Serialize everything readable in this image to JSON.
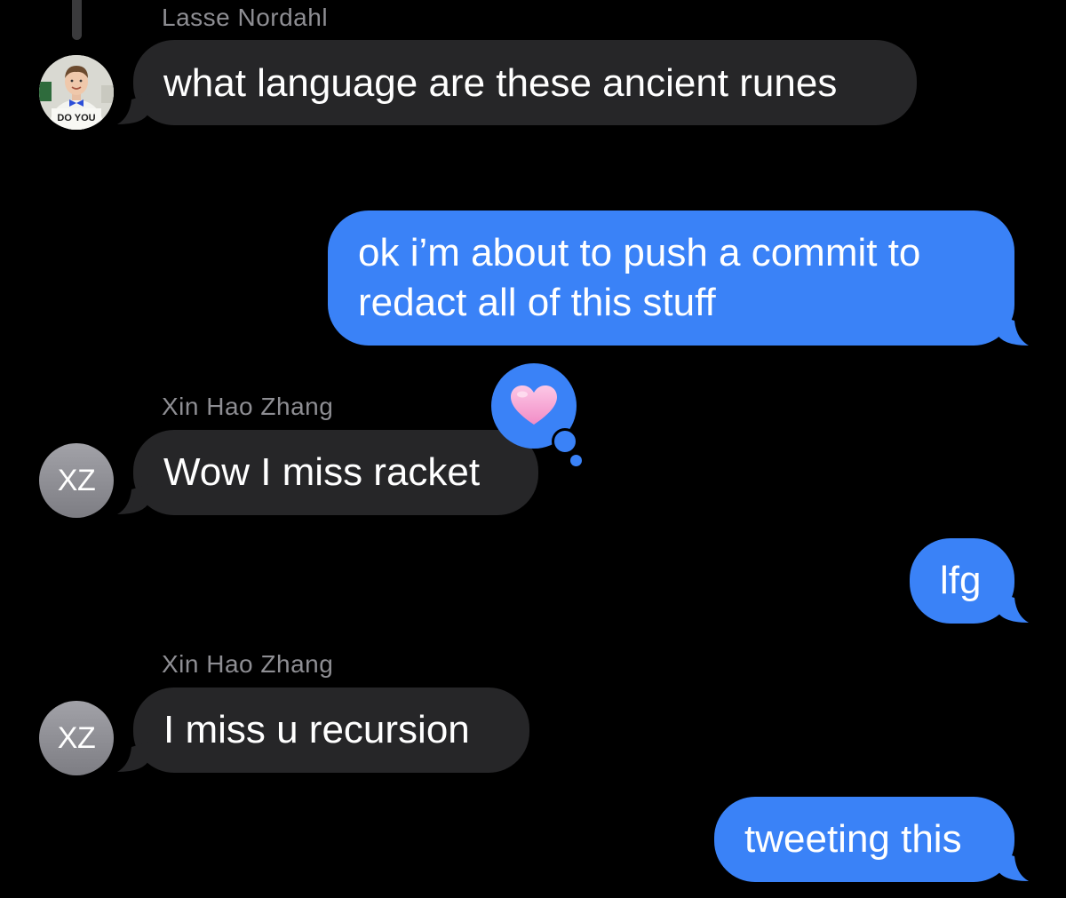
{
  "conversation": {
    "messages": [
      {
        "direction": "incoming",
        "sender": "Lasse Nordahl",
        "avatar": {
          "type": "photo",
          "photo_text": "DO YOU"
        },
        "text": "what language are these ancient runes"
      },
      {
        "direction": "outgoing",
        "lines": [
          "ok i’m about to push a commit to",
          "redact all of this stuff"
        ]
      },
      {
        "direction": "incoming",
        "sender": "Xin Hao Zhang",
        "avatar": {
          "type": "initials",
          "initials": "XZ"
        },
        "text": "Wow I miss racket",
        "tapback": {
          "icon": "heart-icon",
          "color": "#f7a1d2"
        }
      },
      {
        "direction": "outgoing",
        "text": "lfg"
      },
      {
        "direction": "incoming",
        "sender": "Xin Hao Zhang",
        "avatar": {
          "type": "initials",
          "initials": "XZ"
        },
        "text": "I miss u recursion"
      },
      {
        "direction": "outgoing",
        "text": "tweeting this"
      }
    ]
  },
  "colors": {
    "background": "#000000",
    "incoming_bubble": "#262628",
    "outgoing_bubble": "#3a82f7",
    "sender_name": "#8e8e93",
    "avatar_gray": "#8e8e93"
  }
}
